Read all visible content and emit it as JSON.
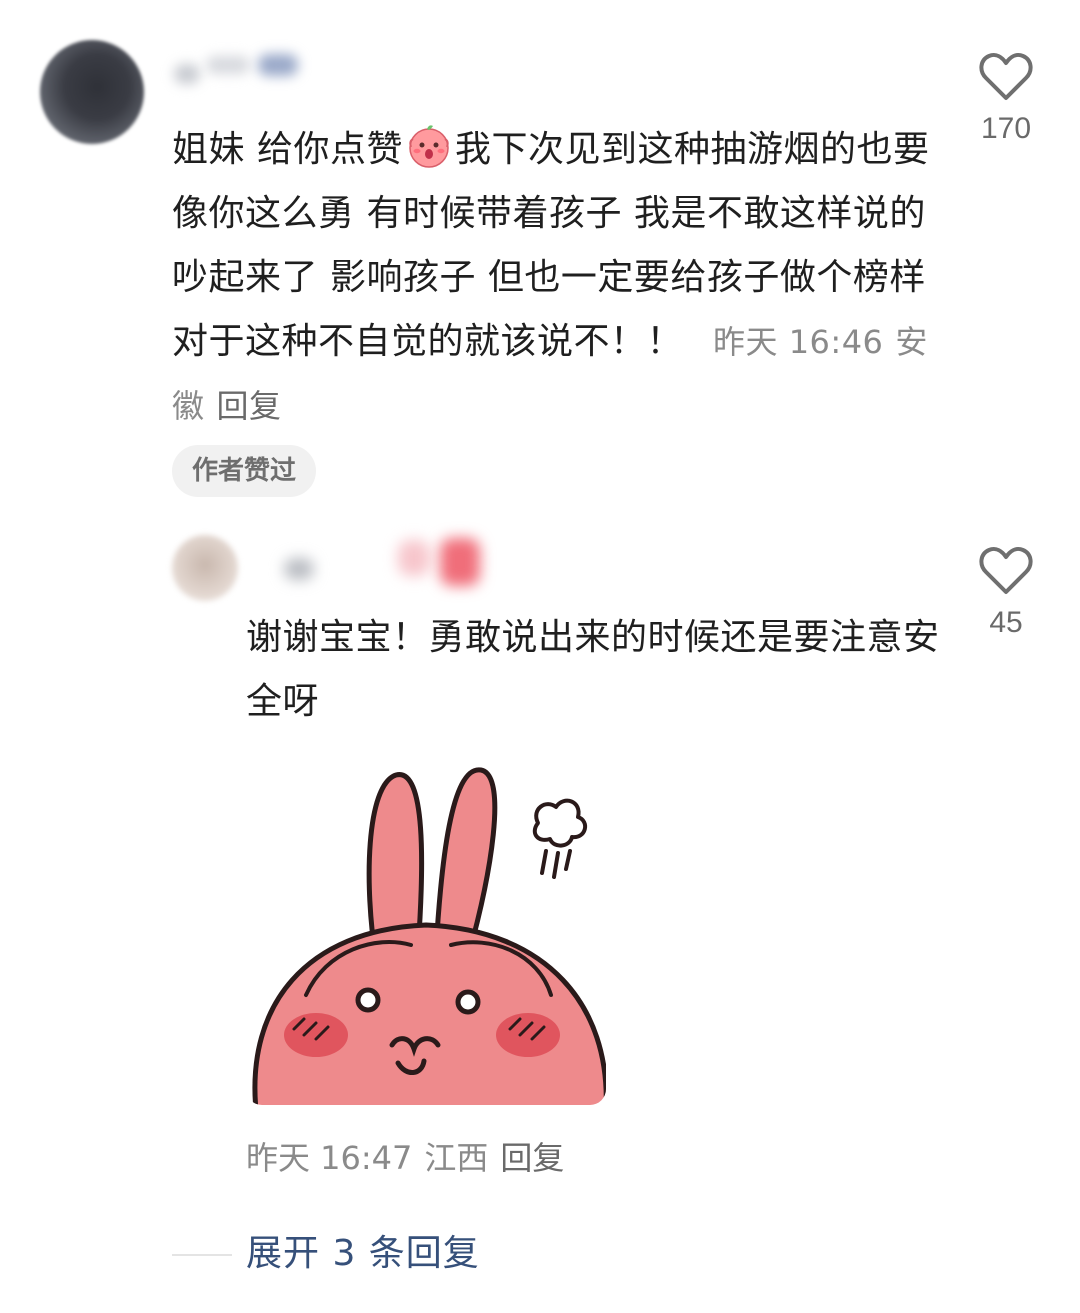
{
  "comment": {
    "text_before_emoji": "姐妹 给你点赞",
    "emoji": "shocked-face-emoji",
    "text_after_emoji": "我下次见到这种抽游烟的也要像你这么勇 有时候带着孩子 我是不敢这样说的 吵起来了 影响孩子 但也一定要给孩子做个榜样 对于这种不自觉的就该说不！！",
    "time": "昨天 16:46",
    "location": "安徽",
    "reply_label": "回复",
    "author_badge": "作者赞过",
    "like_count": "170",
    "like_icon": "heart-outline-icon"
  },
  "reply": {
    "text": "谢谢宝宝！勇敢说出来的时候还是要注意安全呀",
    "sticker": "pink-rabbit-sticker",
    "time": "昨天 16:47",
    "location": "江西",
    "reply_label": "回复",
    "like_count": "45",
    "like_icon": "heart-outline-icon"
  },
  "expand": {
    "label": "展开 3 条回复"
  },
  "colors": {
    "text": "#1f1f1f",
    "meta": "#8a8a8a",
    "link": "#36507a",
    "badge_bg": "#f1f1f1",
    "sticker_pink": "#ee8a8c"
  }
}
